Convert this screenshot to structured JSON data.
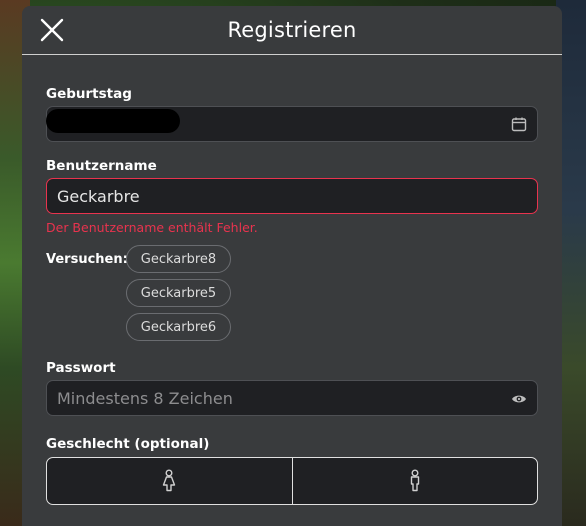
{
  "header": {
    "title": "Registrieren"
  },
  "birthday": {
    "label": "Geburtstag"
  },
  "username": {
    "label": "Benutzername",
    "value": "Geckarbre",
    "error": "Der Benutzername enthält Fehler.",
    "try_label": "Versuchen:",
    "suggestions": [
      "Geckarbre8",
      "Geckarbre5",
      "Geckarbre6"
    ]
  },
  "password": {
    "label": "Passwort",
    "placeholder": "Mindestens 8 Zeichen"
  },
  "gender": {
    "label": "Geschlecht (optional)"
  },
  "colors": {
    "modal_bg": "#393b3d",
    "field_bg": "#1f2023",
    "error": "#e8334e"
  }
}
